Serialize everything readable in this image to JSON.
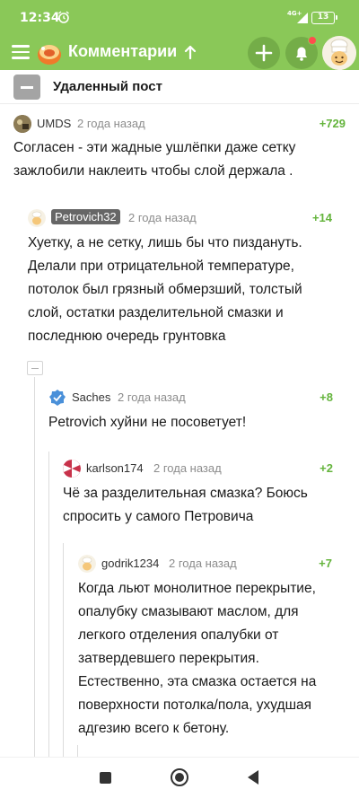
{
  "status_bar": {
    "time": "12:34",
    "network": "4G+",
    "battery": "13"
  },
  "app_bar": {
    "title": "Комментарии"
  },
  "deleted_post": {
    "label": "Удаленный пост"
  },
  "comments": [
    {
      "author": "UMDS",
      "date": "2 года назад",
      "rating": "+729",
      "lines": [
        "Согласен - эти жадные ушлёпки даже сетку",
        "зажлобили наклеить чтобы слой держала ."
      ]
    },
    {
      "author": "Petrovich32",
      "date": "2 года назад",
      "rating": "+14",
      "lines": [
        "Хуетку, а не сетку, лишь бы что пиздануть.",
        "Делали при отрицательной температуре,",
        "потолок был грязный обмерзший, толстый",
        "слой, остатки разделительной смазки и",
        "последнюю очередь грунтовка"
      ]
    },
    {
      "author": "Saches",
      "date": "2 года назад",
      "rating": "+8",
      "lines": [
        "Petrovich хуйни не посоветует!"
      ]
    },
    {
      "author": "karlson174",
      "date": "2 года назад",
      "rating": "+2",
      "lines": [
        "Чё за разделительная смазка? Боюсь",
        "спросить у самого Петровича"
      ]
    },
    {
      "author": "godrik1234",
      "date": "2 года назад",
      "rating": "+7",
      "lines": [
        "Когда льют монолитное перекрытие,",
        "опалубку смазывают маслом, для",
        "легкого отделения опалубки от",
        "затвердевшего перекрытия.",
        "Естественно, эта смазка остается на",
        "поверхности потолка/пола,  ухудшая",
        "адгезию всего к бетону."
      ]
    }
  ],
  "colors": {
    "brand_green": "#8ac858",
    "rating_green": "#64b43c",
    "date_gray": "#8c8c8c"
  },
  "icons": [
    "menu-icon",
    "logo-icon",
    "sort-arrow-icon",
    "plus-icon",
    "bell-icon",
    "user-avatar",
    "stop-icon",
    "home-icon",
    "back-icon"
  ]
}
